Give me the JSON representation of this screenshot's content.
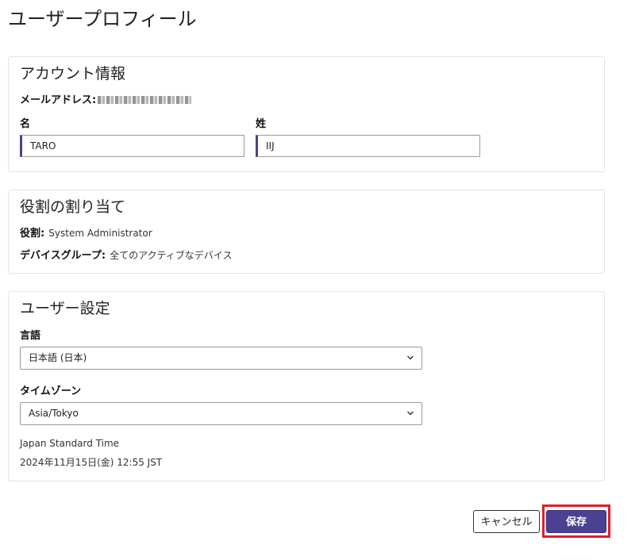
{
  "page": {
    "title": "ユーザープロフィール"
  },
  "account": {
    "section_title": "アカウント情報",
    "email_label": "メールアドレス:",
    "first_name_label": "名",
    "first_name_value": "TARO",
    "last_name_label": "姓",
    "last_name_value": "IIJ"
  },
  "roles": {
    "section_title": "役割の割り当て",
    "role_label": "役割:",
    "role_value": "System Administrator",
    "device_group_label": "デバイスグループ:",
    "device_group_value": "全てのアクティブなデバイス"
  },
  "settings": {
    "section_title": "ユーザー設定",
    "language_label": "言語",
    "language_value": "日本語 (日本)",
    "timezone_label": "タイムゾーン",
    "timezone_value": "Asia/Tokyo",
    "timezone_name": "Japan Standard Time",
    "current_time": "2024年11月15日(金) 12:55 JST"
  },
  "actions": {
    "cancel_label": "キャンセル",
    "save_label": "保存"
  },
  "colors": {
    "primary": "#4a4193",
    "highlight": "#e01e2a"
  }
}
